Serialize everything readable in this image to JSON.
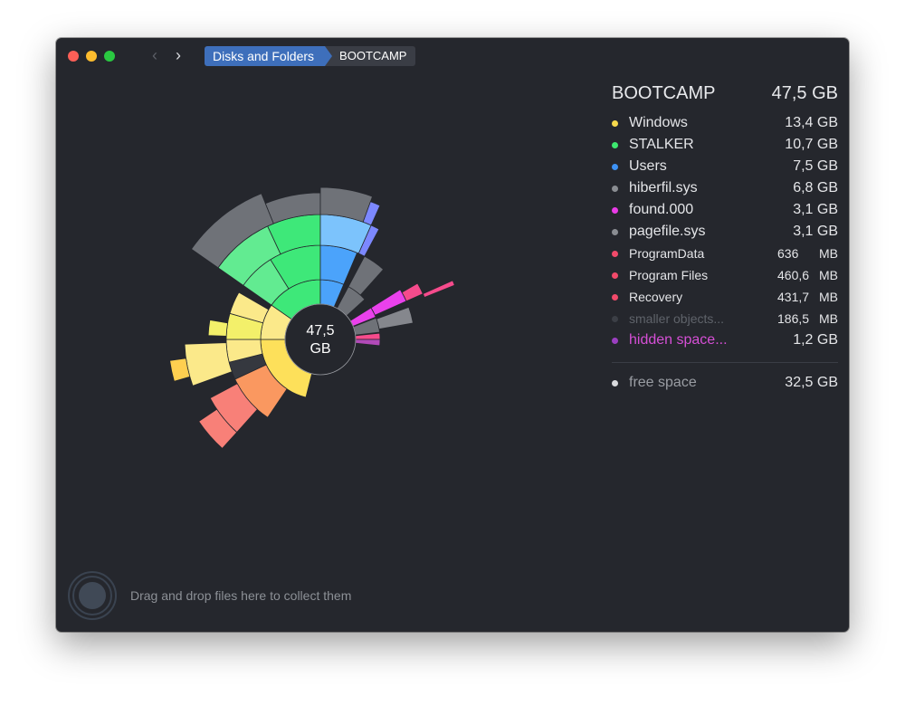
{
  "window": {
    "nav_back": "‹",
    "nav_forward": "›",
    "breadcrumbs": [
      "Disks and Folders",
      "BOOTCAMP"
    ]
  },
  "chart": {
    "center_value": "47,5",
    "center_unit": "GB"
  },
  "summary": {
    "title": "BOOTCAMP",
    "total": "47,5 GB",
    "items": [
      {
        "name": "Windows",
        "size": "13,4 GB",
        "color": "#f7d94c"
      },
      {
        "name": "STALKER",
        "size": "10,7 GB",
        "color": "#3de86f"
      },
      {
        "name": "Users",
        "size": "7,5 GB",
        "color": "#3d92f5"
      },
      {
        "name": "hiberfil.sys",
        "size": "6,8 GB",
        "color": "#8a8d92"
      },
      {
        "name": "found.000",
        "size": "3,1 GB",
        "color": "#e93be6"
      },
      {
        "name": "pagefile.sys",
        "size": "3,1 GB",
        "color": "#8a8d92"
      },
      {
        "name": "ProgramData",
        "size_num": "636",
        "size_unit": "MB",
        "color": "#f24a6a"
      },
      {
        "name": "Program Files",
        "size_num": "460,6",
        "size_unit": "MB",
        "color": "#f24a6a"
      },
      {
        "name": "Recovery",
        "size_num": "431,7",
        "size_unit": "MB",
        "color": "#f24a6a"
      },
      {
        "name": "smaller objects...",
        "size_num": "186,5",
        "size_unit": "MB",
        "color": "#3c3f46"
      },
      {
        "name": "hidden space...",
        "size": "1,2 GB",
        "color": "#9b3fc0"
      }
    ],
    "free_space": {
      "name": "free space",
      "size": "32,5 GB",
      "color": "#d9dadd"
    }
  },
  "drop_zone": {
    "text": "Drag and drop files here to collect them"
  }
}
